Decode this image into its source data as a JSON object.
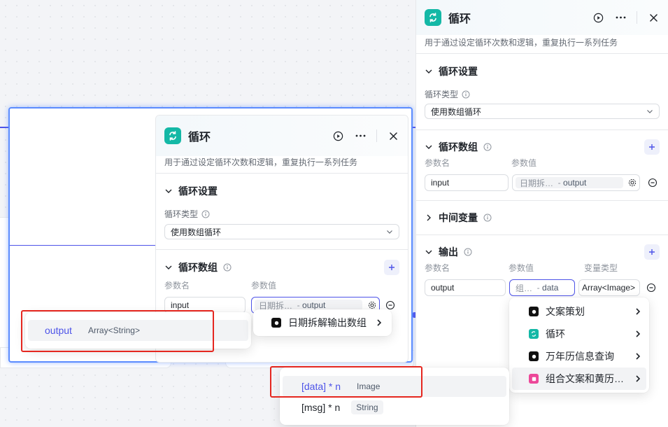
{
  "panel": {
    "title": "循环",
    "description": "用于通过设定循环次数和逻辑，重复执行一系列任务",
    "loop_settings": {
      "title": "循环设置",
      "loop_type_label": "循环类型",
      "loop_type_value": "使用数组循环"
    },
    "loop_array": {
      "title": "循环数组",
      "col_name": "参数名",
      "col_value": "参数值",
      "param_name": "input",
      "ref_source": "日期拆…",
      "ref_var": "output"
    },
    "intermediate": {
      "title": "中间变量"
    },
    "output": {
      "title": "输出",
      "col_name": "参数名",
      "col_value": "参数值",
      "col_type": "变量类型",
      "param_name": "output",
      "ref_source": "组…",
      "ref_var": "data",
      "var_type": "Array<Image>"
    }
  },
  "node_menu": {
    "items": [
      {
        "label": "文案策划",
        "icon": "black-node-icon"
      },
      {
        "label": "循环",
        "icon": "loop-icon"
      },
      {
        "label": "万年历信息查询",
        "icon": "black-node-icon"
      },
      {
        "label": "组合文案和黄历…",
        "icon": "pink-node-icon"
      }
    ]
  },
  "left_output_popup": {
    "name": "output",
    "type": "Array<String>"
  },
  "left_node_popup": {
    "label": "日期拆解输出数组"
  },
  "var_popup": {
    "items": [
      {
        "name": "[data] * n",
        "type": "Image"
      },
      {
        "name": "[msg] * n",
        "type": "String"
      }
    ]
  },
  "colors": {
    "accent": "#4d53e8",
    "loop_icon_bg": "#14b8a6",
    "highlight_border": "#e5261f",
    "selection_glow": "#5b8cff"
  }
}
